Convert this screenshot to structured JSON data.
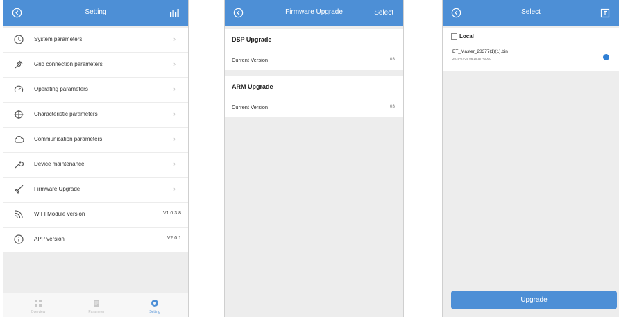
{
  "colors": {
    "accent": "#4d8fd6",
    "selected": "#2f7fd4",
    "background": "#ededed"
  },
  "settings": {
    "title": "Setting",
    "items": [
      {
        "label": "System parameters",
        "icon": "clock-icon",
        "value": ""
      },
      {
        "label": "Grid connection parameters",
        "icon": "plug-icon",
        "value": ""
      },
      {
        "label": "Operating parameters",
        "icon": "gauge-icon",
        "value": ""
      },
      {
        "label": "Characteristic parameters",
        "icon": "crosshair-icon",
        "value": ""
      },
      {
        "label": "Communication parameters",
        "icon": "cloud-icon",
        "value": ""
      },
      {
        "label": "Device maintenance",
        "icon": "wrench-icon",
        "value": ""
      },
      {
        "label": "Firmware Upgrade",
        "icon": "rocket-icon",
        "value": ""
      },
      {
        "label": "WIFI Module version",
        "icon": "wifi-icon",
        "value": "V1.0.3.8"
      },
      {
        "label": "APP version",
        "icon": "info-icon",
        "value": "V2.0.1"
      }
    ],
    "tabs": [
      {
        "label": "Overview",
        "active": false
      },
      {
        "label": "Parameter",
        "active": false
      },
      {
        "label": "Setting",
        "active": true
      }
    ]
  },
  "firmware": {
    "title": "Firmware Upgrade",
    "select_label": "Select",
    "dsp": {
      "title": "DSP Upgrade",
      "version_label": "Current Version",
      "version_value": "03"
    },
    "arm": {
      "title": "ARM Upgrade",
      "version_label": "Current Version",
      "version_value": "03"
    }
  },
  "select": {
    "title": "Select",
    "local_label": "Local",
    "file": {
      "name": "ET_Master_28377(1)(1).bin",
      "date": "2019-07-26 06:18:57 +0000",
      "selected": true
    },
    "upgrade_label": "Upgrade"
  }
}
